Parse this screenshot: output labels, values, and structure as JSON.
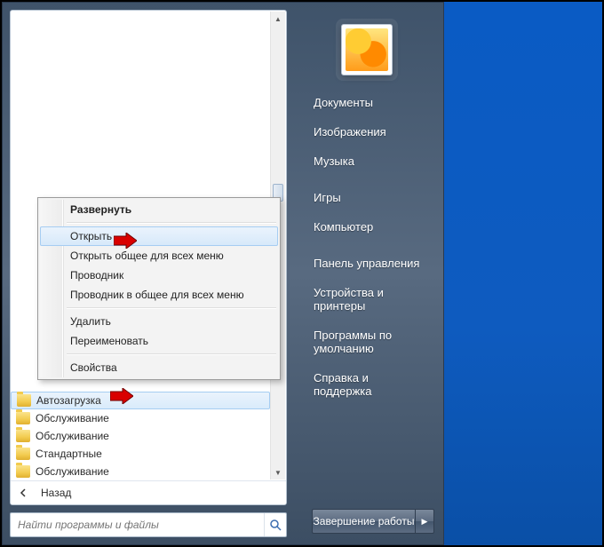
{
  "right_pane": {
    "links": [
      "Документы",
      "Изображения",
      "Музыка",
      "Игры",
      "Компьютер",
      "Панель управления",
      "Устройства и принтеры",
      "Программы по умолчанию",
      "Справка и поддержка"
    ],
    "shutdown_label": "Завершение работы"
  },
  "left_pane": {
    "folders": [
      "Автозагрузка",
      "Обслуживание",
      "Обслуживание",
      "Стандартные",
      "Обслуживание"
    ],
    "selected_index": 0,
    "back_label": "Назад",
    "search_placeholder": "Найти программы и файлы"
  },
  "context_menu": {
    "items": [
      {
        "label": "Развернуть",
        "bold": true
      },
      {
        "sep": true
      },
      {
        "label": "Открыть",
        "hover": true
      },
      {
        "label": "Открыть общее для всех меню"
      },
      {
        "label": "Проводник"
      },
      {
        "label": "Проводник в общее для всех меню"
      },
      {
        "sep": true
      },
      {
        "label": "Удалить"
      },
      {
        "label": "Переименовать"
      },
      {
        "sep": true
      },
      {
        "label": "Свойства"
      }
    ]
  }
}
